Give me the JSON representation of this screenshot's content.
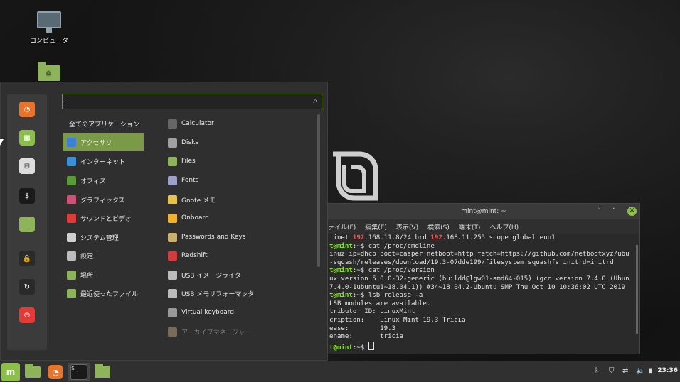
{
  "desktop": {
    "icons": [
      {
        "label": "コンピュータ",
        "icon": "computer-icon"
      },
      {
        "label": "",
        "icon": "home-folder-icon"
      }
    ]
  },
  "menu": {
    "search": {
      "value": "",
      "placeholder": ""
    },
    "favorites": [
      {
        "icon": "firefox-icon",
        "color": "#e8742b"
      },
      {
        "icon": "software-manager-icon",
        "color": "#8cbf4a"
      },
      {
        "icon": "settings-toggle-icon",
        "color": "#dddddd"
      },
      {
        "icon": "terminal-icon",
        "color": "#1a1a1a"
      },
      {
        "icon": "folder-icon",
        "color": "#8fb35a"
      },
      {
        "icon": "lock-icon",
        "color": "#2a2a2a"
      },
      {
        "icon": "logout-icon",
        "color": "#2a2a2a"
      },
      {
        "icon": "power-icon",
        "color": "#e53935"
      }
    ],
    "categories": [
      {
        "label": "全てのアプリケーション",
        "icon": ""
      },
      {
        "label": "アクセサリ",
        "icon": "accessories-icon",
        "color": "#3f7fd8"
      },
      {
        "label": "インターネット",
        "icon": "internet-icon",
        "color": "#3a8fd8"
      },
      {
        "label": "オフィス",
        "icon": "office-icon",
        "color": "#5a9a3a"
      },
      {
        "label": "グラフィックス",
        "icon": "graphics-icon",
        "color": "#d0507a"
      },
      {
        "label": "サウンドとビデオ",
        "icon": "sound-video-icon",
        "color": "#e03b3b"
      },
      {
        "label": "システム管理",
        "icon": "system-admin-icon",
        "color": "#cfcfcf"
      },
      {
        "label": "設定",
        "icon": "settings-icon",
        "color": "#bdbdbd"
      },
      {
        "label": "場所",
        "icon": "places-icon",
        "color": "#8fb35a"
      },
      {
        "label": "最近使ったファイル",
        "icon": "recent-files-icon",
        "color": "#8fb35a"
      }
    ],
    "selected_category": "アクセサリ",
    "apps": [
      {
        "label": "Calculator",
        "icon": "calculator-icon",
        "color": "#666666"
      },
      {
        "label": "Disks",
        "icon": "disks-icon",
        "color": "#a0a0a0"
      },
      {
        "label": "Files",
        "icon": "files-icon",
        "color": "#8fb35a"
      },
      {
        "label": "Fonts",
        "icon": "fonts-icon",
        "color": "#9aa0c8"
      },
      {
        "label": "Gnote メモ",
        "icon": "gnote-icon",
        "color": "#e8c24a"
      },
      {
        "label": "Onboard",
        "icon": "onboard-icon",
        "color": "#f0b030"
      },
      {
        "label": "Passwords and Keys",
        "icon": "keys-icon",
        "color": "#c8b070"
      },
      {
        "label": "Redshift",
        "icon": "redshift-icon",
        "color": "#d23c3c"
      },
      {
        "label": "USB イメージライタ",
        "icon": "usb-image-icon",
        "color": "#bbbbbb"
      },
      {
        "label": "USB メモリフォーマッタ",
        "icon": "usb-format-icon",
        "color": "#bbbbbb"
      },
      {
        "label": "Virtual keyboard",
        "icon": "keyboard-icon",
        "color": "#999999"
      },
      {
        "label": "アーカイブマネージャー",
        "icon": "archive-icon",
        "color": "#7a6a5a"
      }
    ]
  },
  "terminal": {
    "title": "mint@mint: ~",
    "menu": [
      "ァイル(F)",
      "編集(E)",
      "表示(V)",
      "検索(S)",
      "端末(T)",
      "ヘルプ(H)"
    ],
    "lines": [
      {
        "parts": [
          {
            "t": " inet ",
            "c": ""
          },
          {
            "t": "192",
            "c": "ip"
          },
          {
            "t": ".168.11.8/24 brd ",
            "c": ""
          },
          {
            "t": "192",
            "c": "ip"
          },
          {
            "t": ".168.11.255 scope global eno1",
            "c": ""
          }
        ]
      },
      {
        "parts": [
          {
            "t": "t@mint",
            "c": "pr"
          },
          {
            "t": ":~$ cat /proc/cmdline",
            "c": ""
          }
        ]
      },
      {
        "parts": [
          {
            "t": "inuz ip=dhcp boot=casper netboot=http fetch=https://github.com/netbootxyz/ubu",
            "c": ""
          }
        ]
      },
      {
        "parts": [
          {
            "t": "-squash/releases/download/19.3-07dde199/filesystem.squashfs initrd=initrd",
            "c": ""
          }
        ]
      },
      {
        "parts": [
          {
            "t": "t@mint",
            "c": "pr"
          },
          {
            "t": ":~$ cat /proc/version",
            "c": ""
          }
        ]
      },
      {
        "parts": [
          {
            "t": "ux version 5.0.0-32-generic (buildd@lgw01-amd64-015) (gcc version 7.4.0 (Ubun",
            "c": ""
          }
        ]
      },
      {
        "parts": [
          {
            "t": "7.4.0-1ubuntu1~18.04.1)) #34~18.04.2-Ubuntu SMP Thu Oct 10 10:36:02 UTC 2019",
            "c": ""
          }
        ]
      },
      {
        "parts": [
          {
            "t": "t@mint",
            "c": "pr"
          },
          {
            "t": ":~$ lsb_release -a",
            "c": ""
          }
        ]
      },
      {
        "parts": [
          {
            "t": "LSB modules are available.",
            "c": ""
          }
        ]
      },
      {
        "parts": [
          {
            "t": "tributor ID: LinuxMint",
            "c": ""
          }
        ]
      },
      {
        "parts": [
          {
            "t": "cription:    Linux Mint 19.3 Tricia",
            "c": ""
          }
        ]
      },
      {
        "parts": [
          {
            "t": "ease:        19.3",
            "c": ""
          }
        ]
      },
      {
        "parts": [
          {
            "t": "ename:       tricia",
            "c": ""
          }
        ]
      },
      {
        "parts": [
          {
            "t": "t@mint",
            "c": "pr"
          },
          {
            "t": ":~$ ",
            "c": ""
          }
        ],
        "cursor": true
      }
    ]
  },
  "panel": {
    "launchers": [
      "mint-menu-icon",
      "folder-icon",
      "firefox-icon",
      "terminal-icon",
      "folder-icon"
    ],
    "tray": [
      "bluetooth-icon",
      "update-icon",
      "network-icon",
      "volume-icon",
      "battery-icon"
    ],
    "clock": "23:36"
  }
}
